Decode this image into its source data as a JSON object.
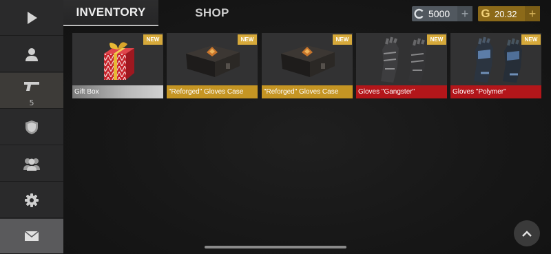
{
  "sidebar": {
    "items": [
      {
        "icon": "play-icon"
      },
      {
        "icon": "profile-icon"
      },
      {
        "icon": "pistol-icon",
        "badge": "5"
      },
      {
        "icon": "shield-icon"
      },
      {
        "icon": "clan-icon"
      },
      {
        "icon": "gear-icon"
      },
      {
        "icon": "mail-icon"
      }
    ]
  },
  "tabs": {
    "inventory": "INVENTORY",
    "shop": "SHOP"
  },
  "currency": {
    "silver": "5000",
    "gold_symbol": "G",
    "gold": "20.32",
    "plus": "+"
  },
  "items": [
    {
      "name": "Gift Box",
      "badge": "NEW",
      "rarity": "common"
    },
    {
      "name": "\"Reforged\" Gloves Case",
      "badge": "NEW",
      "rarity": "rare"
    },
    {
      "name": "\"Reforged\" Gloves Case",
      "badge": "NEW",
      "rarity": "rare"
    },
    {
      "name": "Gloves \"Gangster\"",
      "badge": "NEW",
      "rarity": "epic"
    },
    {
      "name": "Gloves \"Polymer\"",
      "badge": "NEW",
      "rarity": "epic"
    }
  ],
  "colors": {
    "rare": "#c59523",
    "epic": "#b3161a",
    "badge": "#d6a93a",
    "silver_bg": "#51585f",
    "gold_bg": "#8c6a19"
  }
}
